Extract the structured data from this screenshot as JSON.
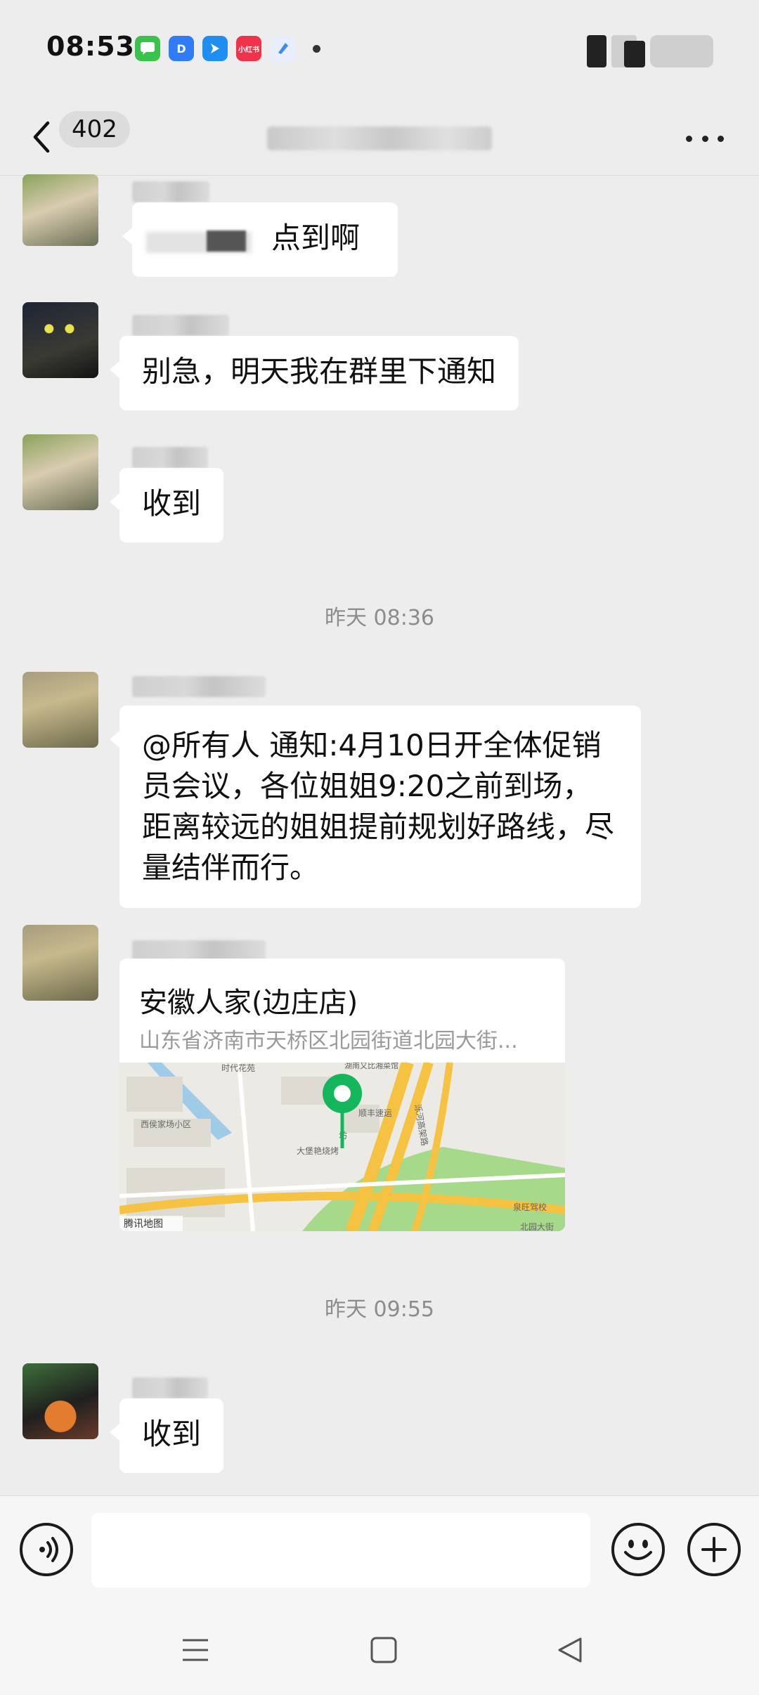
{
  "status_bar": {
    "time": "08:53",
    "notification_icons": [
      {
        "name": "messages-app-icon",
        "color": "#3ac34a",
        "glyph": ""
      },
      {
        "name": "dingtalk-app-icon",
        "color": "#2f7cf6",
        "glyph": "D"
      },
      {
        "name": "feishu-app-icon",
        "color": "#1f8ef1",
        "glyph": ""
      },
      {
        "name": "xiaohongshu-app-icon",
        "color": "#f0334a",
        "glyph": "小红书"
      },
      {
        "name": "cloud-app-icon",
        "color": "#3b8bf0",
        "glyph": ""
      }
    ]
  },
  "nav": {
    "unread_count": "402"
  },
  "messages": [
    {
      "type": "text",
      "text": "点到啊"
    },
    {
      "type": "text",
      "text": "别急，明天我在群里下通知"
    },
    {
      "type": "text",
      "text": "收到"
    },
    {
      "type": "time",
      "text": "昨天 08:36"
    },
    {
      "type": "text",
      "text": "@所有人  通知:4月10日开全体促销员会议，各位姐姐9:20之前到场，距离较远的姐姐提前规划好路线，尽量结伴而行。"
    },
    {
      "type": "location",
      "name": "安徽人家(边庄店)",
      "address": "山东省济南市天桥区北园街道北园大街...",
      "map_labels": [
        "时代花苑",
        "西侯家场小区",
        "湖南又比湘菜馆",
        "顺丰速运",
        "坊",
        "大堡艳烧烤",
        "泺河高架路",
        "泉旺驾校",
        "北园大街",
        "腾讯地图"
      ]
    },
    {
      "type": "time",
      "text": "昨天 09:55"
    },
    {
      "type": "text",
      "text": "收到"
    }
  ],
  "colors": {
    "background": "#ededed",
    "bubble": "#ffffff",
    "map_pin": "#13b65a",
    "road_yellow": "#f5c242",
    "park_green": "#a7d98a"
  }
}
